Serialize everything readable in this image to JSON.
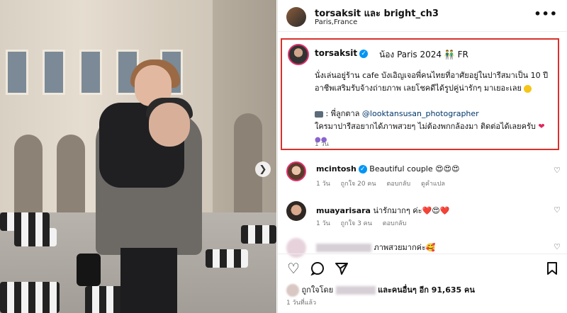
{
  "header": {
    "title": "torsaksit และ bright_ch3",
    "location": "Paris,France",
    "more_icon": "more-horizontal-icon"
  },
  "caption": {
    "username": "torsaksit",
    "tag_line": "น้อง Paris 2024 👬 FR",
    "line1": "นั่งเล่นอยู่ร้าน cafe บังเอิญเจอพี่คนไทยที่อาศัยอยู่ในปารีสมาเป็น 10 ปี",
    "line2": "อาชีพเสริมรับจ้างถ่ายภาพ เลยโชคดีได้รูปคู่น่ารักๆ มาเยอะเลย",
    "line3_prefix": ": พี่ลูกตาล",
    "mention": "@looktansusan_photographer",
    "line4": "ใครมาปารีสอยากได้ภาพสวยๆ ไม่ต้องพกกล้องมา ติดต่อได้เลยครับ",
    "time": "1 วัน"
  },
  "comments": [
    {
      "username": "mcintosh",
      "text": "Beautiful couple 😍😍😍",
      "time": "1 วัน",
      "likes": "ถูกใจ 20 คน",
      "reply": "ตอบกลับ",
      "translate": "ดูคำแปล"
    },
    {
      "username": "muayarisara",
      "text": "น่ารักมากๆ ค่ะ❤️😍❤️",
      "time": "1 วัน",
      "likes": "ถูกใจ 3 คน",
      "reply": "ตอบกลับ"
    },
    {
      "username": "",
      "text": "ภาพสวยมากค่ะ🥰",
      "time": "",
      "likes": "",
      "reply": ""
    }
  ],
  "likes_line": {
    "prefix": "ถูกใจโดย",
    "suffix": "และคนอื่นๆ อีก 91,635 คน"
  },
  "posted": "1 วันที่แล้ว",
  "icons": {
    "like": "heart-icon",
    "comment": "comment-icon",
    "share": "send-icon",
    "save": "bookmark-icon",
    "next": "chevron-right-icon"
  },
  "colors": {
    "highlight_border": "#d9312b",
    "link": "#00376b",
    "verified": "#0095f6"
  }
}
